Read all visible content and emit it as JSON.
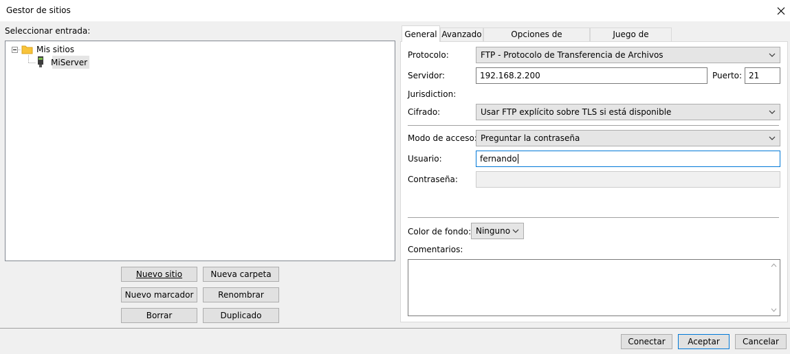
{
  "window": {
    "title": "Gestor de sitios"
  },
  "left": {
    "select_label": "Seleccionar entrada:",
    "tree": [
      {
        "label": "Mis sitios",
        "icon": "folder-icon",
        "expanded": true
      },
      {
        "label": "MiServer",
        "icon": "server-icon",
        "selected": true
      }
    ],
    "buttons": {
      "new_site": "Nuevo sitio",
      "new_folder": "Nueva carpeta",
      "new_bookmark": "Nuevo marcador",
      "rename": "Renombrar",
      "delete": "Borrar",
      "duplicate": "Duplicado"
    }
  },
  "tabs": [
    "General",
    "Avanzado",
    "Opciones de Transferencia",
    "Juego de caracteres"
  ],
  "general": {
    "protocol_label": "Protocolo:",
    "protocol_value": "FTP - Protocolo de Transferencia de Archivos",
    "server_label": "Servidor:",
    "server_value": "192.168.2.200",
    "port_label": "Puerto:",
    "port_value": "21",
    "jurisdiction_label": "Jurisdiction:",
    "encryption_label": "Cifrado:",
    "encryption_value": "Usar FTP explícito sobre TLS si está disponible",
    "access_mode_label": "Modo de acceso:",
    "access_mode_value": "Preguntar la contraseña",
    "user_label": "Usuario:",
    "user_value": "fernando",
    "password_label": "Contraseña:",
    "bgcolor_label": "Color de fondo:",
    "bgcolor_value": "Ninguno",
    "comments_label": "Comentarios:"
  },
  "footer": {
    "connect": "Conectar",
    "accept": "Aceptar",
    "cancel": "Cancelar"
  }
}
